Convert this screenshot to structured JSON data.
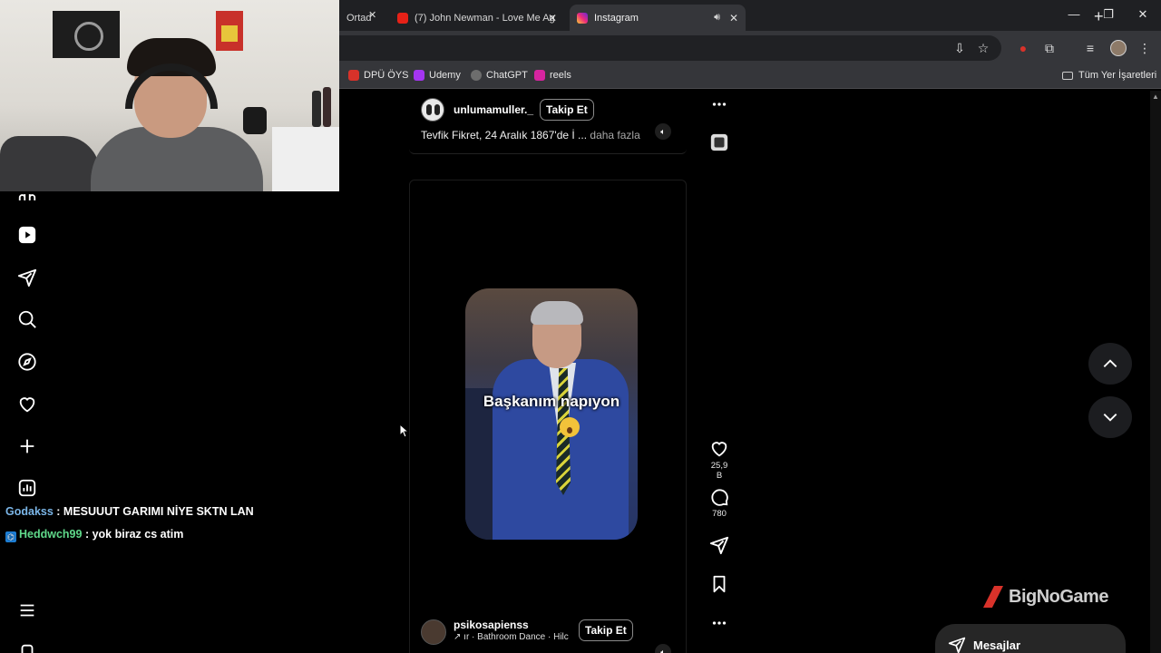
{
  "browser": {
    "tabs": [
      {
        "label": "Ortad",
        "active": false
      },
      {
        "label": "(7) John Newman - Love Me Ag",
        "active": false
      },
      {
        "label": "Instagram",
        "active": true
      }
    ],
    "close_glyph": "✕",
    "new_tab_glyph": "+",
    "window_controls": {
      "minimize": "—",
      "restore": "❐",
      "close": "✕"
    },
    "bookmarks": [
      {
        "label": "DPÜ ÖYS",
        "color": "#d8322a"
      },
      {
        "label": "Udemy",
        "color": "#a435f0"
      },
      {
        "label": "ChatGPT",
        "color": "#9a9a9a"
      },
      {
        "label": "reels",
        "color": "#d6249f"
      }
    ],
    "all_bookmarks": "Tüm Yer İşaretleri"
  },
  "chat": [
    {
      "user": "Godakss",
      "message": ": MESUUUT GARIMI NİYE SKTN LAN"
    },
    {
      "user": "Heddwch99",
      "message": ": yok biraz cs atim"
    }
  ],
  "reels": {
    "previous": {
      "username": "unlumamuller._",
      "follow_label": "Takip Et",
      "caption": "Tevfik Fikret, 24 Aralık 1867'de İ ...",
      "more_label": "daha fazla"
    },
    "current": {
      "overlay_text": "Başkanım napıyon",
      "username": "psikosapienss",
      "follow_label": "Takip Et",
      "audio_text": "ır · Bathroom Dance · Hilc",
      "likes": "25,9 B",
      "comments": "780"
    }
  },
  "messages_label": "Mesajlar",
  "watermark": "BigNoGame",
  "colors": {
    "accent_red": "#d8322a",
    "chat_user_blue": "#7bb6e8",
    "chat_user_green": "#5fd98a"
  }
}
